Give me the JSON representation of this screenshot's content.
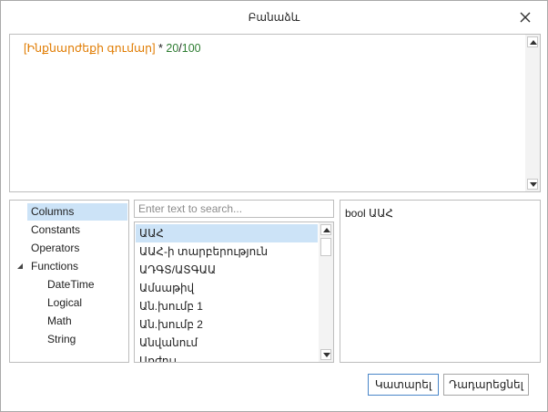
{
  "dialog": {
    "title": "Բանաձև"
  },
  "editor": {
    "expression": {
      "field": "[Ինքնարժեքի գումար]",
      "op1": " * ",
      "num1": "20",
      "op2": "/",
      "num2": "100"
    }
  },
  "tree": {
    "items": [
      {
        "label": "Columns",
        "selected": true
      },
      {
        "label": "Constants"
      },
      {
        "label": "Operators"
      },
      {
        "label": "Functions",
        "expanded": true
      },
      {
        "label": "DateTime"
      },
      {
        "label": "Logical"
      },
      {
        "label": "Math"
      },
      {
        "label": "String"
      }
    ]
  },
  "search": {
    "placeholder": "Enter text to search...",
    "value": ""
  },
  "list": {
    "items": [
      {
        "label": "ԱԱՀ",
        "selected": true
      },
      {
        "label": "ԱԱՀ-ի տարբերություն"
      },
      {
        "label": "ԱԴԳՏ/ԱՏԳԱԱ"
      },
      {
        "label": "Ամսաթիվ"
      },
      {
        "label": "Ան.խումբ 1"
      },
      {
        "label": "Ան.խումբ 2"
      },
      {
        "label": "Անվանում"
      },
      {
        "label": "Առժույ"
      }
    ]
  },
  "description": {
    "text": "bool ԱԱՀ"
  },
  "buttons": {
    "ok": "Կատարել",
    "cancel": "Դադարեցնել"
  },
  "icons": {
    "close": "close-icon",
    "scroll_up": "arrow-up-icon",
    "scroll_down": "arrow-down-icon",
    "expander": "triangle-expanded-icon"
  },
  "colors": {
    "field_token": "#e07b00",
    "number_token": "#2e7d32",
    "selection": "#cce3f7",
    "primary_border": "#4a86c8"
  }
}
